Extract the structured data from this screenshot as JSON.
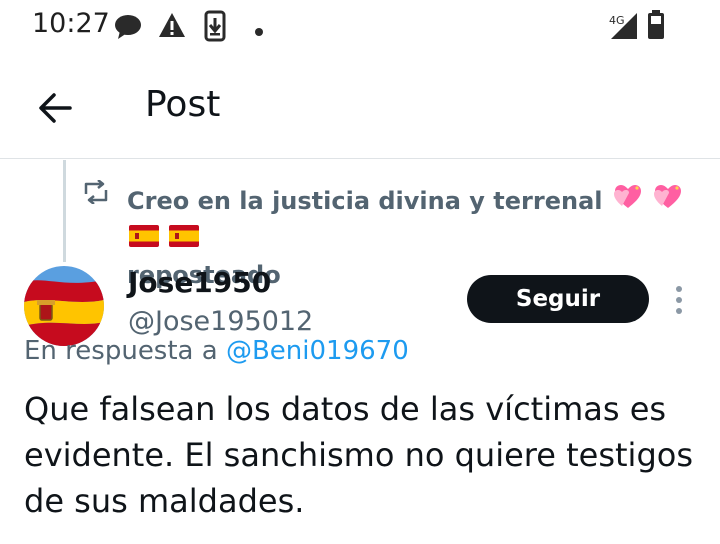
{
  "status_bar": {
    "time": "10:27",
    "network": "4G",
    "icons": [
      "chat-bubble-icon",
      "warning-icon",
      "download-icon",
      "dot-icon",
      "signal-icon",
      "battery-icon"
    ]
  },
  "header": {
    "title": "Post",
    "back_icon": "arrow-left-icon"
  },
  "repost": {
    "icon": "repost-icon",
    "user": "Creo en la justicia divina y terrenal",
    "emojis": [
      "sparkling-heart",
      "sparkling-heart",
      "flag-spain",
      "flag-spain"
    ],
    "suffix": "reposteado"
  },
  "post": {
    "author_name": "Jose1950",
    "author_handle": "@Jose195012",
    "follow_label": "Seguir",
    "reply_prefix": "En respuesta a",
    "reply_to": "@Beni019670",
    "text": "Que falsean los datos de las víctimas es evidente. El sanchismo no quiere testigos de sus maldades."
  },
  "colors": {
    "text_primary": "#0f1419",
    "text_secondary": "#536471",
    "link": "#1d9bf0",
    "follow_bg": "#0f1419"
  }
}
